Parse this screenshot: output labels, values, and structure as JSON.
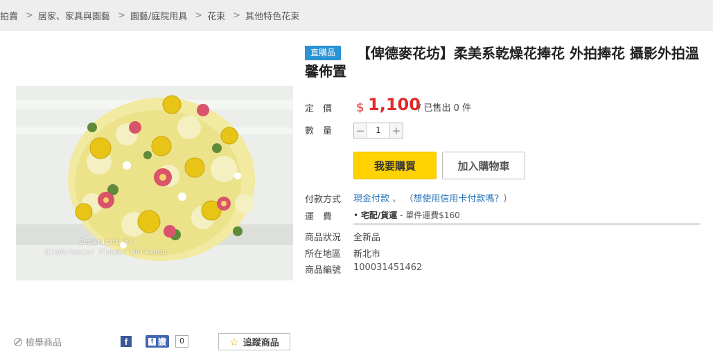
{
  "breadcrumb": [
    {
      "label": "拍賣",
      "sep": false
    },
    {
      "label": "居家、家具與園藝",
      "sep": true
    },
    {
      "label": "園藝/庭院用具",
      "sep": true
    },
    {
      "label": "花束",
      "sep": true
    },
    {
      "label": "其他特色花束",
      "sep": true
    }
  ],
  "breadcrumb_sep": ">",
  "product": {
    "badge": "直購品",
    "title": "【俾德麥花坊】柔美系乾燥花捧花 外拍捧花 攝影外拍溫馨佈置",
    "image_watermark_line1": "Copyright by",
    "image_watermark_line2": "Biedermeier Flower Workshop"
  },
  "price": {
    "label": "定　價",
    "currency": "$",
    "value": "1,100",
    "sold_text": "/ 已售出 0 件"
  },
  "quantity": {
    "label": "數　量",
    "minus": "−",
    "value": "1",
    "plus": "+"
  },
  "buttons": {
    "buy": "我要購買",
    "cart": "加入購物車",
    "follow": "追蹤商品"
  },
  "payment": {
    "label": "付款方式",
    "method": "現金付款",
    "separator": "、",
    "credit_prefix": "（",
    "credit_link": "想使用信用卡付款嗎？",
    "credit_suffix": "）"
  },
  "shipping": {
    "label": "運　費",
    "method": "宅配/貨運",
    "detail": " - 單件運費$160"
  },
  "info": {
    "condition_label": "商品狀況",
    "condition_value": "全新品",
    "location_label": "所在地區",
    "location_value": "新北市",
    "id_label": "商品編號",
    "id_value": "100031451462"
  },
  "social": {
    "report": "檢舉商品",
    "like_label": "讚",
    "like_count": "0"
  },
  "colors": {
    "accent_blue": "#2a93d5",
    "price_red": "#e02a2a",
    "buy_yellow": "#ffd200",
    "link_blue": "#1f6fb5"
  }
}
